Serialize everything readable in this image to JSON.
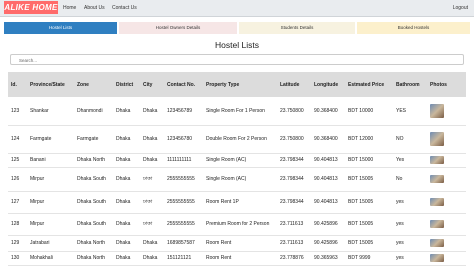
{
  "brand": "ALIKE HOME",
  "nav": {
    "home": "Home",
    "about": "About Us",
    "contact": "Contact Us",
    "logout": "Logout"
  },
  "tabs": [
    "Hostel Lists",
    "Hostel Owners Details",
    "Students Details",
    "Booked Hostels"
  ],
  "page_title": "Hostel Lists",
  "search": {
    "placeholder": "Search..."
  },
  "table": {
    "headers": [
      "Id.",
      "Province/State",
      "Zone",
      "District",
      "City",
      "Contact No.",
      "Property Type",
      "Latitude",
      "Longitude",
      "Estmated Price",
      "Bathroom",
      "Photos"
    ],
    "rows": [
      [
        "123",
        "Shankar",
        "Dhanmondi",
        "Dhaka",
        "Dhaka",
        "123456789",
        "Single Room For 1 Person",
        "23.750800",
        "90.368400",
        "BDT 10000",
        "YES",
        ""
      ],
      [
        "124",
        "Farmgate",
        "Farmgate",
        "Dhaka",
        "Dhaka",
        "123456780",
        "Double Room For 2 Person",
        "23.750800",
        "90.368400",
        "BDT 12000",
        "NO",
        ""
      ],
      [
        "125",
        "Banani",
        "Dhaka North",
        "Dhaka",
        "Dhaka",
        "1111111111",
        "Single Room (AC)",
        "23.798344",
        "90.404813",
        "BDT 15000",
        "Yes",
        ""
      ],
      [
        "126",
        "Mirpur",
        "Dhaka South",
        "Dhaka",
        "ঢাকা",
        "2555555555",
        "Single Room (AC)",
        "23.798344",
        "90.404813",
        "BDT 15005",
        "No",
        ""
      ],
      [
        "127",
        "Mirpur",
        "Dhaka South",
        "Dhaka",
        "ঢাকা",
        "2555555555",
        "Room Rent 1P",
        "23.798344",
        "90.404813",
        "BDT 15005",
        "yes",
        ""
      ],
      [
        "128",
        "Mirpur",
        "Dhaka South",
        "Dhaka",
        "ঢাকা",
        "2555555555",
        "Premium Room for 2 Person",
        "23.711613",
        "90.425896",
        "BDT 15005",
        "yes",
        ""
      ],
      [
        "129",
        "Jatrabari",
        "Dhaka North",
        "Dhaka",
        "Dhaka",
        "1689857587",
        "Room Rent",
        "23.711613",
        "90.425896",
        "BDT 15005",
        "yes",
        ""
      ],
      [
        "130",
        "Mohakhali",
        "Dhaka North",
        "Dhaka",
        "Dhaka",
        "151121121",
        "Room Rent",
        "23.778876",
        "90.365963",
        "BDT 9999",
        "yes",
        ""
      ]
    ]
  }
}
